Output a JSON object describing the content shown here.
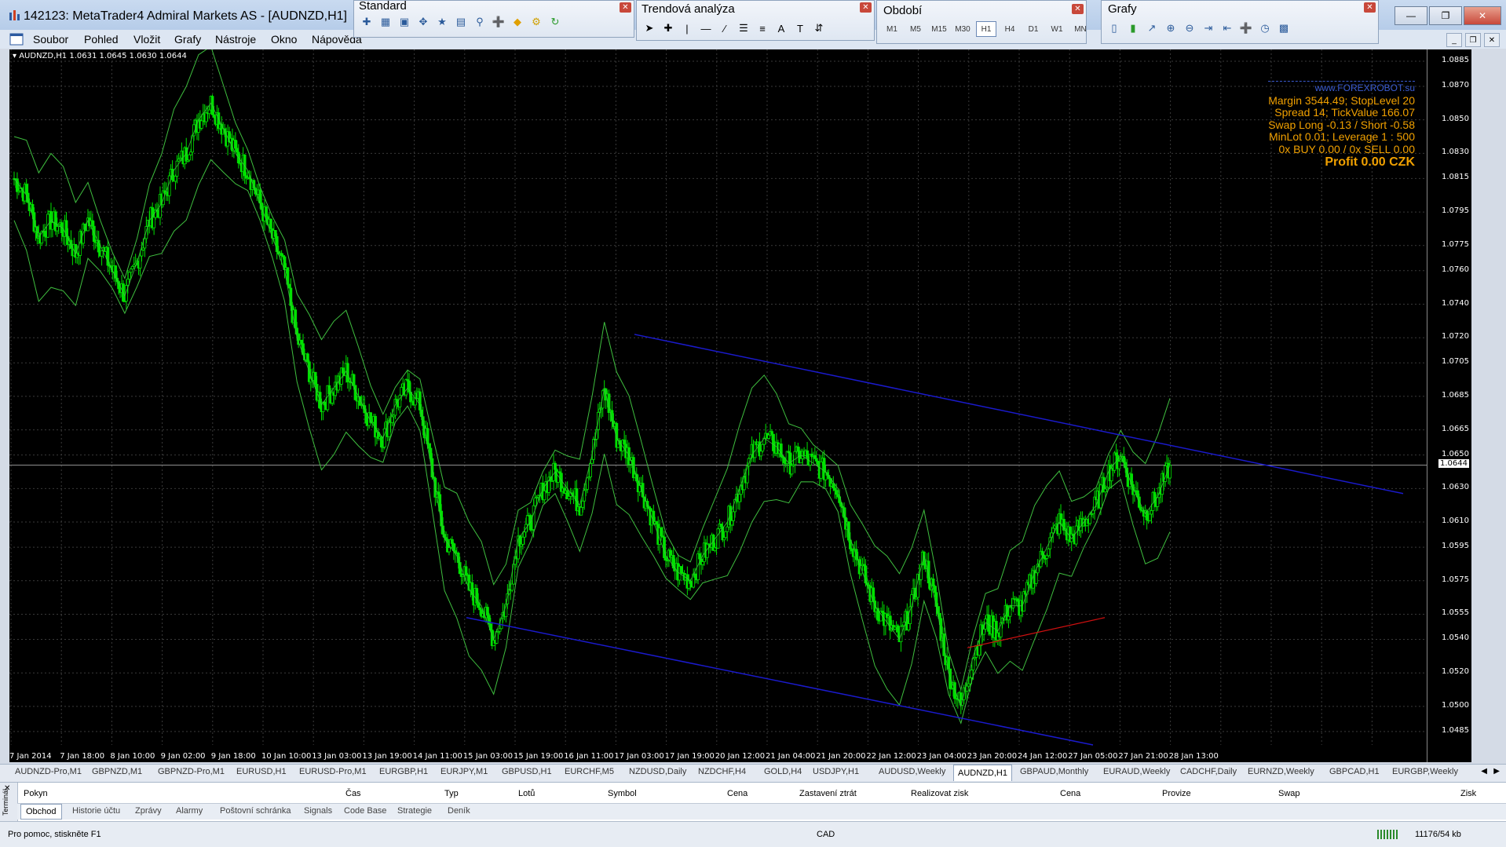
{
  "window": {
    "title": "142123: MetaTrader4 Admiral Markets AS - [AUDNZD,H1]"
  },
  "menu": [
    "Soubor",
    "Pohled",
    "Vložit",
    "Grafy",
    "Nástroje",
    "Okno",
    "Nápověda"
  ],
  "toolbars": {
    "standard": {
      "title": "Standard"
    },
    "trend": {
      "title": "Trendová analýza"
    },
    "period": {
      "title": "Období",
      "timeframes": [
        "M1",
        "M5",
        "M15",
        "M30",
        "H1",
        "H4",
        "D1",
        "W1",
        "MN"
      ],
      "active": "H1"
    },
    "charts": {
      "title": "Grafy"
    }
  },
  "chart": {
    "header": "AUDNZD,H1  1.0631 1.0645 1.0630 1.0644",
    "info": {
      "site": "www.FOREXROBOT.su",
      "lines": [
        "Margin 3544.49; StopLevel 20",
        "Spread 14; TickValue 166.07",
        "Swap Long -0.13 / Short -0.58",
        "MinLot 0.01; Leverage 1 : 500",
        "0x BUY 0.00 / 0x SELL 0.00"
      ],
      "profit": "Profit 0.00 CZK"
    },
    "current_price": "1.0644",
    "colors": {
      "candles": "#00e000",
      "bands": "#3fbf3f",
      "trendline": "#1a1acc",
      "support": "#d01010",
      "grid": "#3a3a3a"
    }
  },
  "chart_data": {
    "type": "line",
    "title": "AUDNZD,H1",
    "y_ticks": [
      "1.0885",
      "1.0870",
      "1.0850",
      "1.0830",
      "1.0815",
      "1.0795",
      "1.0775",
      "1.0760",
      "1.0740",
      "1.0720",
      "1.0705",
      "1.0685",
      "1.0665",
      "1.0650",
      "1.0630",
      "1.0610",
      "1.0595",
      "1.0575",
      "1.0555",
      "1.0540",
      "1.0520",
      "1.0500",
      "1.0485"
    ],
    "x_ticks": [
      "7 Jan 2014",
      "7 Jan 18:00",
      "8 Jan 10:00",
      "9 Jan 02:00",
      "9 Jan 18:00",
      "10 Jan 10:00",
      "13 Jan 03:00",
      "13 Jan 19:00",
      "14 Jan 11:00",
      "15 Jan 03:00",
      "15 Jan 19:00",
      "16 Jan 11:00",
      "17 Jan 03:00",
      "17 Jan 19:00",
      "20 Jan 12:00",
      "21 Jan 04:00",
      "21 Jan 20:00",
      "22 Jan 12:00",
      "23 Jan 04:00",
      "23 Jan 20:00",
      "24 Jan 12:00",
      "27 Jan 05:00",
      "27 Jan 21:00",
      "28 Jan 13:00"
    ],
    "ylim": [
      1.0477,
      1.0892
    ],
    "series": [
      {
        "values": [
          1.0815,
          1.0805,
          1.078,
          1.079,
          1.0785,
          1.077,
          1.079,
          1.0775,
          1.076,
          1.0745,
          1.0765,
          1.079,
          1.08,
          1.082,
          1.083,
          1.085,
          1.086,
          1.0845,
          1.083,
          1.082,
          1.08,
          1.078,
          1.076,
          1.072,
          1.07,
          1.068,
          1.069,
          1.07,
          1.0685,
          1.067,
          1.066,
          1.068,
          1.069,
          1.068,
          1.064,
          1.06,
          1.059,
          1.057,
          1.056,
          1.054,
          1.056,
          1.06,
          1.061,
          1.063,
          1.064,
          1.063,
          1.062,
          1.065,
          1.069,
          1.066,
          1.065,
          1.063,
          1.061,
          1.059,
          1.058,
          1.0575,
          1.059,
          1.06,
          1.061,
          1.063,
          1.065,
          1.066,
          1.0655,
          1.0645,
          1.065,
          1.0645,
          1.064,
          1.063,
          1.06,
          1.058,
          1.056,
          1.055,
          1.054,
          1.056,
          1.059,
          1.056,
          1.052,
          1.05,
          1.053,
          1.055,
          1.0545,
          1.056,
          1.056,
          1.058,
          1.0595,
          1.061,
          1.06,
          1.061,
          1.062,
          1.064,
          1.065,
          1.063,
          1.0615,
          1.0625,
          1.0644
        ]
      }
    ]
  },
  "symbol_tabs": [
    "AUDNZD-Pro,M1",
    "GBPNZD,M1",
    "GBPNZD-Pro,M1",
    "EURUSD,H1",
    "EURUSD-Pro,M1",
    "EURGBP,H1",
    "EURJPY,M1",
    "GBPUSD,H1",
    "EURCHF,M5",
    "NZDUSD,Daily",
    "NZDCHF,H4",
    "GOLD,H4",
    "USDJPY,H1",
    "AUDUSD,Weekly",
    "AUDNZD,H1",
    "GBPAUD,Monthly",
    "EURAUD,Weekly",
    "CADCHF,Daily",
    "EURNZD,Weekly",
    "GBPCAD,H1",
    "EURGBP,Weekly"
  ],
  "active_symbol_tab": "AUDNZD,H1",
  "terminal": {
    "columns": [
      "Pokyn",
      "Čas",
      "Typ",
      "Lotů",
      "Symbol",
      "Cena",
      "Zastavení ztrát",
      "Realizovat zisk",
      "Cena",
      "Provize",
      "Swap",
      "Zisk"
    ],
    "tabs": [
      "Obchod",
      "Historie účtu",
      "Zprávy",
      "Alarmy",
      "Poštovní schránka",
      "Signals",
      "Code Base",
      "Strategie",
      "Deník"
    ],
    "side_label": "Terminál"
  },
  "status": {
    "help": "Pro pomoc, stiskněte F1",
    "profile": "CAD",
    "traffic": "11176/54 kb"
  }
}
